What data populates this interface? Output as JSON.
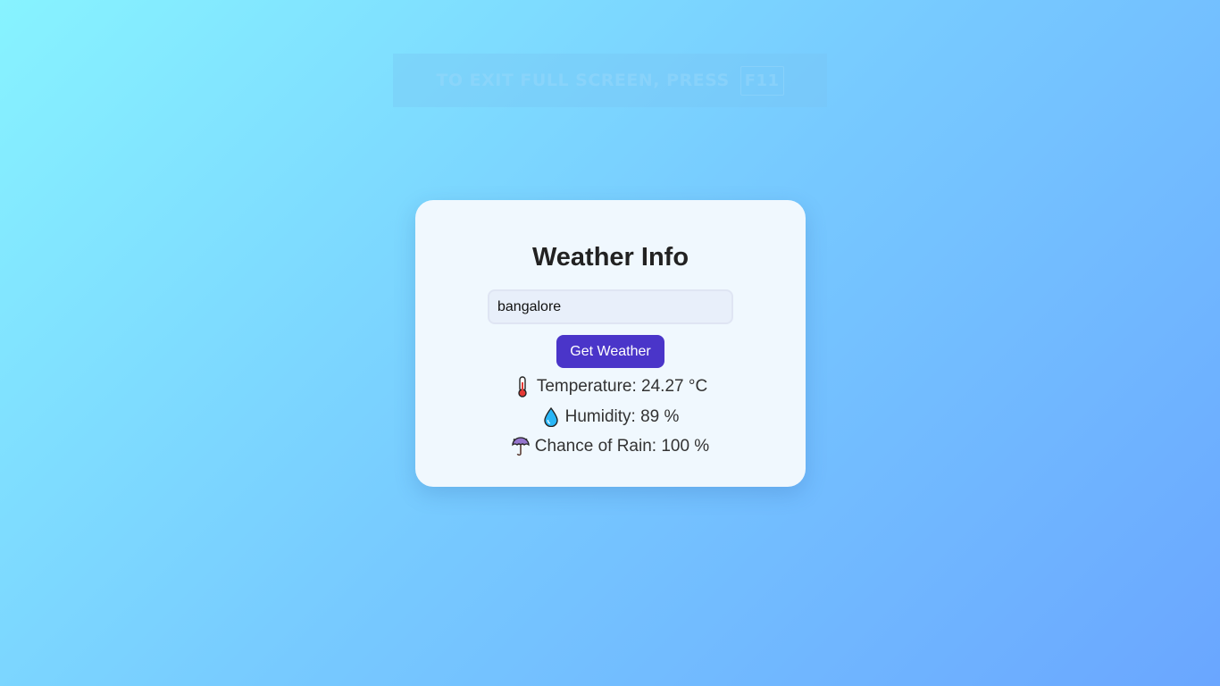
{
  "fullscreen_banner": {
    "text": "TO EXIT FULL SCREEN, PRESS",
    "key": "F11"
  },
  "card": {
    "title": "Weather Info",
    "city_input": {
      "value": "bangalore",
      "placeholder": ""
    },
    "button_label": "Get Weather",
    "results": {
      "temperature": {
        "icon": "thermometer-icon",
        "text": "Temperature: 24.27 °C"
      },
      "humidity": {
        "icon": "droplet-icon",
        "text": "Humidity: 89 %"
      },
      "rain": {
        "icon": "umbrella-rain-icon",
        "text": "Chance of Rain: 100 %"
      }
    }
  },
  "colors": {
    "button": "#4a35c9",
    "card_bg": "#f0f8fe",
    "bg_start": "#87f3ff",
    "bg_end": "#6aa6ff"
  }
}
